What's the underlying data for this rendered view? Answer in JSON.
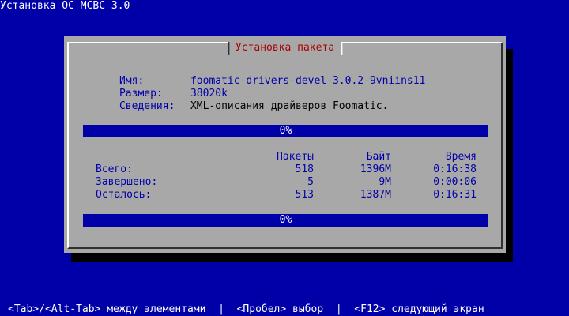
{
  "window": {
    "title": "Установка ОС МСВС 3.0"
  },
  "dialog": {
    "title": "Установка пакета",
    "name_label": "Имя:",
    "name_value": "foomatic-drivers-devel-3.0.2-9vniins11",
    "size_label": "Размер:",
    "size_value": "38020k",
    "info_label": "Сведения:",
    "info_value": "XML-описания драйверов Foomatic.",
    "progress_package_percent": "0%",
    "progress_total_percent": "0%",
    "stats": {
      "headers": {
        "packages": "Пакеты",
        "bytes": "Байт",
        "time": "Время"
      },
      "rows": [
        {
          "label": "Всего:",
          "packages": "518",
          "bytes": "1396M",
          "time": "0:16:38"
        },
        {
          "label": "Завершено:",
          "packages": "5",
          "bytes": "9M",
          "time": "0:00:06"
        },
        {
          "label": "Осталось:",
          "packages": "513",
          "bytes": "1387M",
          "time": "0:16:31"
        }
      ]
    }
  },
  "footer": {
    "hint": "<Tab>/<Alt-Tab> между элементами  |  <Пробел> выбор  |  <F12> следующий экран"
  },
  "colors": {
    "background": "#0000a8",
    "dialog": "#a8a8a8",
    "title": "#a80000",
    "text": "#0000a8"
  }
}
